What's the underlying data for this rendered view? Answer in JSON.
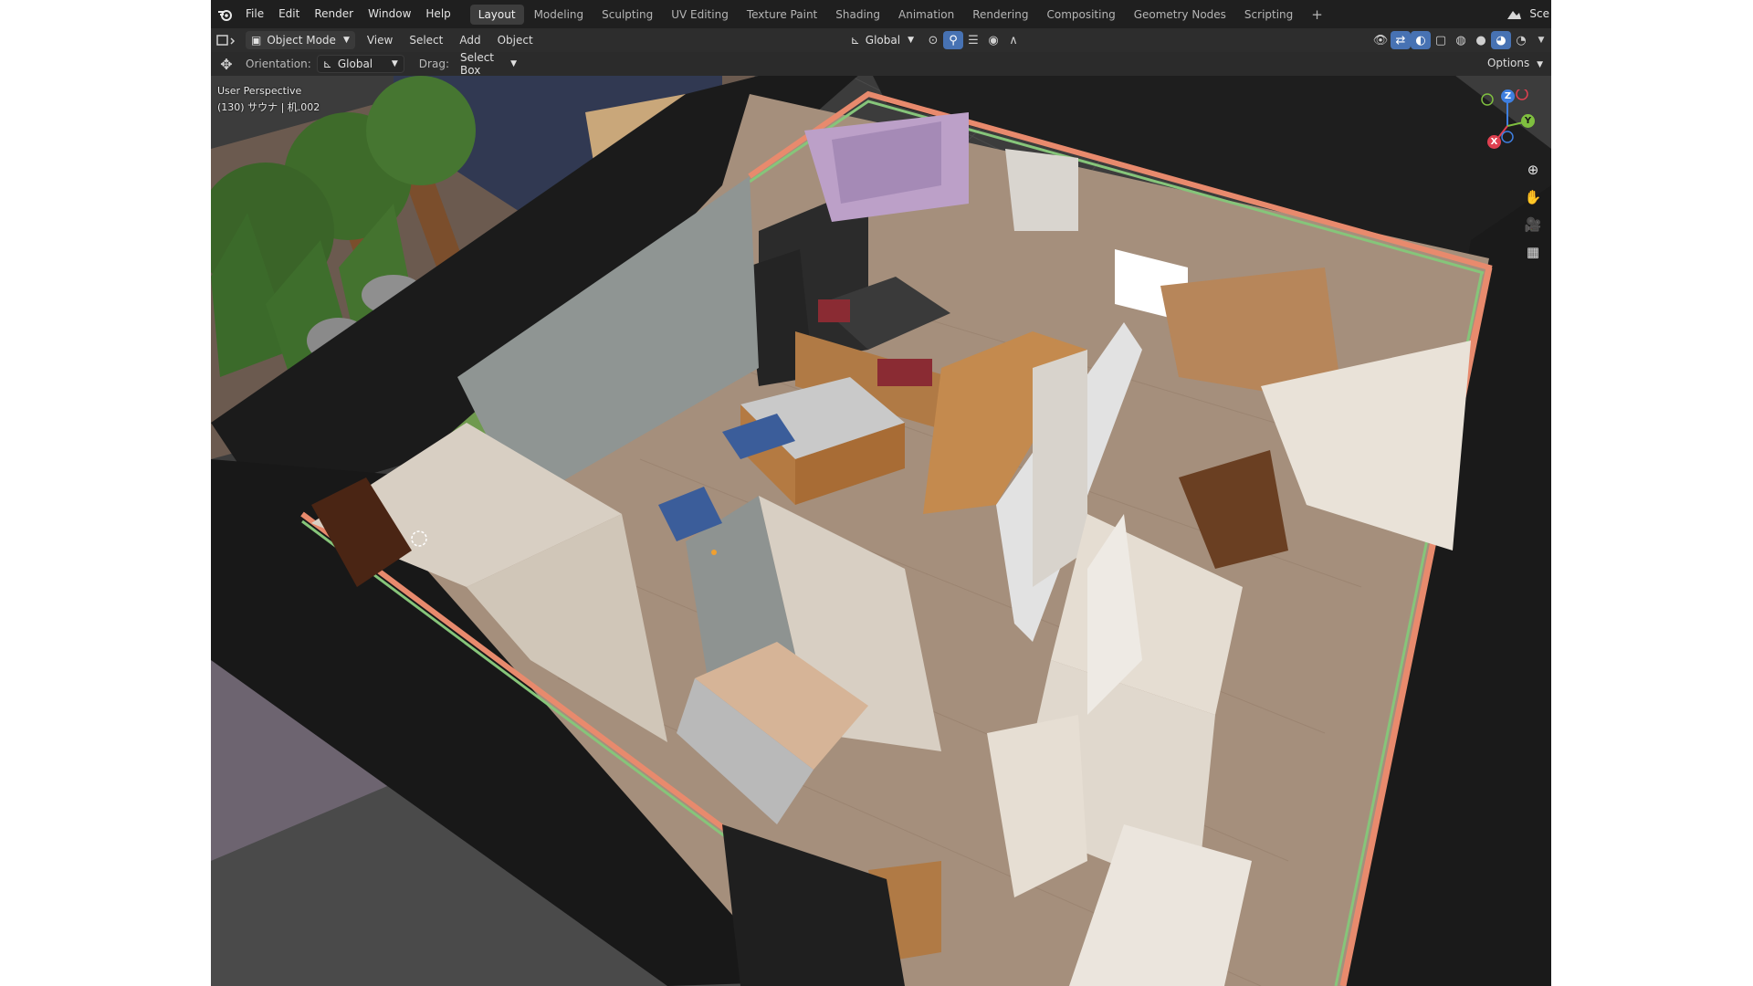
{
  "topbar": {
    "menu": [
      "File",
      "Edit",
      "Render",
      "Window",
      "Help"
    ],
    "workspaces": [
      {
        "label": "Layout",
        "active": true
      },
      {
        "label": "Modeling",
        "active": false
      },
      {
        "label": "Sculpting",
        "active": false
      },
      {
        "label": "UV Editing",
        "active": false
      },
      {
        "label": "Texture Paint",
        "active": false
      },
      {
        "label": "Shading",
        "active": false
      },
      {
        "label": "Animation",
        "active": false
      },
      {
        "label": "Rendering",
        "active": false
      },
      {
        "label": "Compositing",
        "active": false
      },
      {
        "label": "Geometry Nodes",
        "active": false
      },
      {
        "label": "Scripting",
        "active": false
      }
    ],
    "add_tab": "+",
    "scene_label": "Sce"
  },
  "header": {
    "mode": "Object Mode",
    "menus": [
      "View",
      "Select",
      "Add",
      "Object"
    ],
    "transform_orientation": "Global",
    "options_label": "Options"
  },
  "toolrow": {
    "orientation_label": "Orientation:",
    "orientation_value": "Global",
    "drag_label": "Drag:",
    "drag_value": "Select Box"
  },
  "viewport": {
    "perspective": "User Perspective",
    "object_info": "(130) サウナ | 机.002"
  },
  "gizmo": {
    "z": "Z",
    "y": "Y",
    "x": "X"
  },
  "colors": {
    "accent": "#4772b3",
    "x_axis": "#e04050",
    "y_axis": "#7fbf3f",
    "z_axis": "#3f7fe0"
  }
}
